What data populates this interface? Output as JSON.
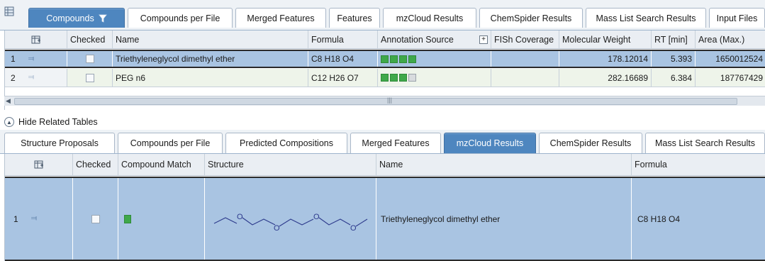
{
  "top_tabs": [
    {
      "label": "Compounds",
      "active": true
    },
    {
      "label": "Compounds per File"
    },
    {
      "label": "Merged Features"
    },
    {
      "label": "Features"
    },
    {
      "label": "mzCloud Results"
    },
    {
      "label": "ChemSpider Results"
    },
    {
      "label": "Mass List Search Results"
    },
    {
      "label": "Input Files"
    }
  ],
  "top_table": {
    "headers": {
      "checked": "Checked",
      "name": "Name",
      "formula": "Formula",
      "annotation_source": "Annotation Source",
      "annotation_expand": "+",
      "fish": "FISh Coverage",
      "mw": "Molecular Weight",
      "rt": "RT [min]",
      "area": "Area (Max.)"
    },
    "rows": [
      {
        "index": "1",
        "name": "Triethyleneglycol dimethyl ether",
        "formula": "C8 H18 O4",
        "annotation": [
          1,
          1,
          1,
          1
        ],
        "mw": "178.12014",
        "rt": "5.393",
        "area": "1650012524"
      },
      {
        "index": "2",
        "name": "PEG n6",
        "formula": "C12 H26 O7",
        "annotation": [
          1,
          1,
          1,
          0
        ],
        "mw": "282.16689",
        "rt": "6.384",
        "area": "187767429"
      }
    ]
  },
  "hide_related": {
    "label": "Hide Related Tables"
  },
  "bottom_tabs": [
    {
      "label": "Structure Proposals"
    },
    {
      "label": "Compounds per File"
    },
    {
      "label": "Predicted Compositions"
    },
    {
      "label": "Merged Features"
    },
    {
      "label": "mzCloud Results",
      "active": true
    },
    {
      "label": "ChemSpider Results"
    },
    {
      "label": "Mass List Search Results"
    }
  ],
  "bottom_table": {
    "headers": {
      "checked": "Checked",
      "compound_match": "Compound Match",
      "structure": "Structure",
      "name": "Name",
      "formula": "Formula"
    },
    "rows": [
      {
        "index": "1",
        "name": "Triethyleneglycol dimethyl ether",
        "formula": "C8 H18 O4",
        "structure_atoms": [
          "O",
          "O",
          "O",
          "O"
        ]
      }
    ]
  },
  "colors": {
    "active_tab": "#4e86bf",
    "selected_row": "#a9c4e2",
    "annotation_green": "#3fa84a"
  },
  "icons": {
    "filter": "filter-icon",
    "pin": "pin-icon",
    "grid": "grid-settings-icon",
    "collapse": "chevron-up-icon"
  }
}
